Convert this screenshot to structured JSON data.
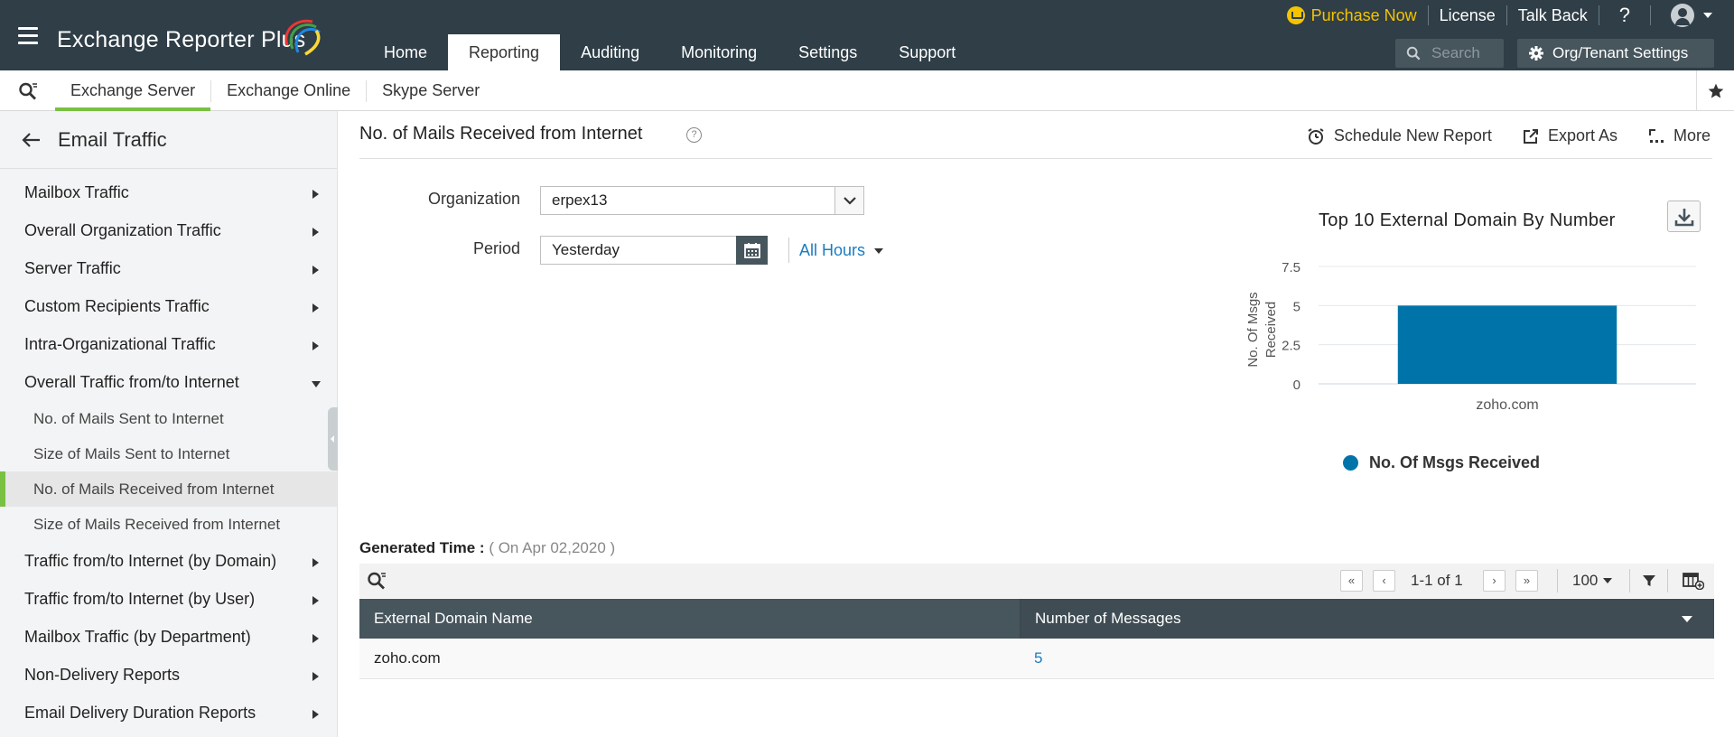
{
  "app": {
    "title": "Exchange Reporter Plus"
  },
  "header": {
    "nav_tabs": [
      "Home",
      "Reporting",
      "Auditing",
      "Monitoring",
      "Settings",
      "Support"
    ],
    "active_tab": "Reporting",
    "purchase": "Purchase Now",
    "license": "License",
    "talk_back": "Talk Back",
    "help": "?",
    "search_placeholder": "Search",
    "org_settings": "Org/Tenant Settings"
  },
  "subbar": {
    "tabs": [
      "Exchange Server",
      "Exchange Online",
      "Skype Server"
    ],
    "active_tab": "Exchange Server"
  },
  "sidebar": {
    "title": "Email Traffic",
    "items": [
      {
        "label": "Mailbox Traffic"
      },
      {
        "label": "Overall Organization Traffic"
      },
      {
        "label": "Server Traffic"
      },
      {
        "label": "Custom Recipients Traffic"
      },
      {
        "label": "Intra-Organizational Traffic"
      },
      {
        "label": "Overall Traffic from/to Internet"
      },
      {
        "label": "No. of Mails Sent to Internet"
      },
      {
        "label": "Size of Mails Sent to Internet"
      },
      {
        "label": "No. of Mails Received from Internet"
      },
      {
        "label": "Size of Mails Received from Internet"
      },
      {
        "label": "Traffic from/to Internet (by Domain)"
      },
      {
        "label": "Traffic from/to Internet (by User)"
      },
      {
        "label": "Mailbox Traffic (by Department)"
      },
      {
        "label": "Non-Delivery Reports"
      },
      {
        "label": "Email Delivery Duration Reports"
      }
    ]
  },
  "report": {
    "title": "No. of Mails Received from Internet",
    "actions": {
      "schedule": "Schedule New Report",
      "export": "Export As",
      "more": "More"
    },
    "filters": {
      "organization_label": "Organization",
      "organization_value": "erpex13",
      "period_label": "Period",
      "period_value": "Yesterday",
      "hours": "All Hours"
    },
    "generated_label": "Generated Time :",
    "generated_value": "( On Apr 02,2020 )"
  },
  "chart_data": {
    "type": "bar",
    "title": "Top 10 External Domain By Number",
    "categories": [
      "zoho.com"
    ],
    "series": [
      {
        "name": "No. Of Msgs Received",
        "values": [
          5
        ]
      }
    ],
    "ylabel": "No. Of Msgs Received",
    "xlabel": "",
    "ylim": [
      0,
      7.5
    ],
    "yticks": [
      "0",
      "2.5",
      "5",
      "7.5"
    ],
    "grid": true,
    "legend": "bottom",
    "bar_color": "#0074a8"
  },
  "table": {
    "pagination": "1-1 of 1",
    "page_size": "100",
    "columns": [
      "External Domain Name",
      "Number of Messages"
    ],
    "rows": [
      [
        "zoho.com",
        "5"
      ]
    ]
  }
}
